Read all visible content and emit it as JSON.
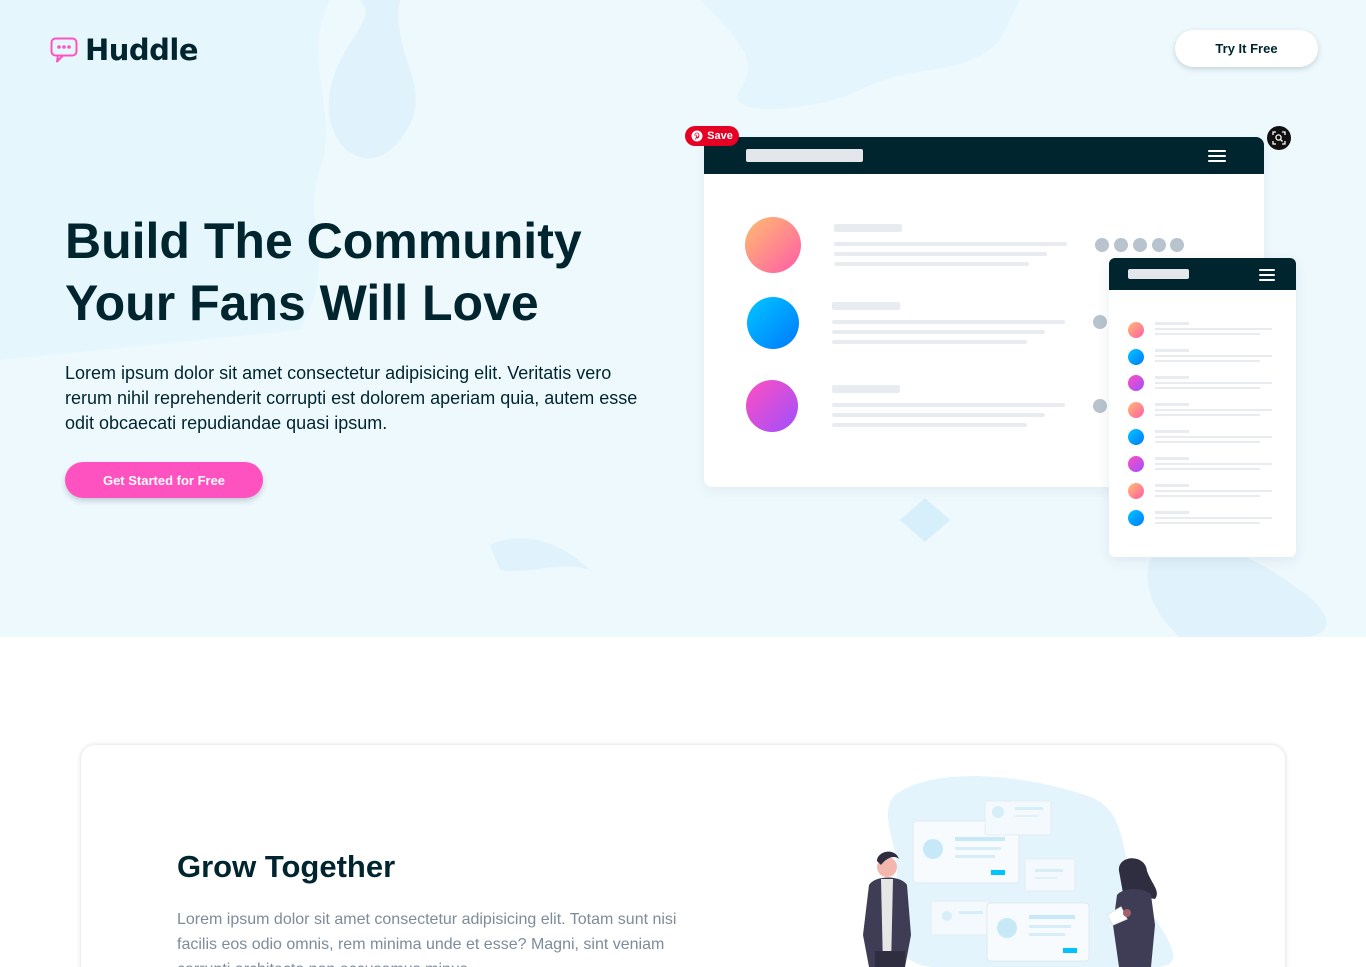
{
  "header": {
    "logo_text": "Huddle",
    "try_button": "Try It Free"
  },
  "hero": {
    "title_line1": "Build The Community",
    "title_line2": "Your Fans Will Love",
    "text": "Lorem ipsum dolor sit amet consectetur adipisicing elit. Veritatis vero rerum nihil reprehenderit corrupti est dolorem aperiam quia, autem esse odit obcaecati repudiandae quasi ipsum.",
    "cta_button": "Get Started for Free"
  },
  "overlay": {
    "pinterest_save": "Save"
  },
  "feature": {
    "title": "Grow Together",
    "text": "Lorem ipsum dolor sit amet consectetur adipisicing elit. Totam sunt nisi facilis eos odio omnis, rem minima unde et esse? Magni, sint veniam corrupti architecto non accusamus minus."
  },
  "colors": {
    "dark": "#00252e",
    "pink": "#ff52c1",
    "hero_bg": "#eef9fe",
    "muted": "#7e8b99",
    "pinterest": "#e60023"
  },
  "icons": [
    "chat-bubble-logo-icon",
    "menu-icon",
    "pinterest-icon",
    "visual-search-icon"
  ]
}
